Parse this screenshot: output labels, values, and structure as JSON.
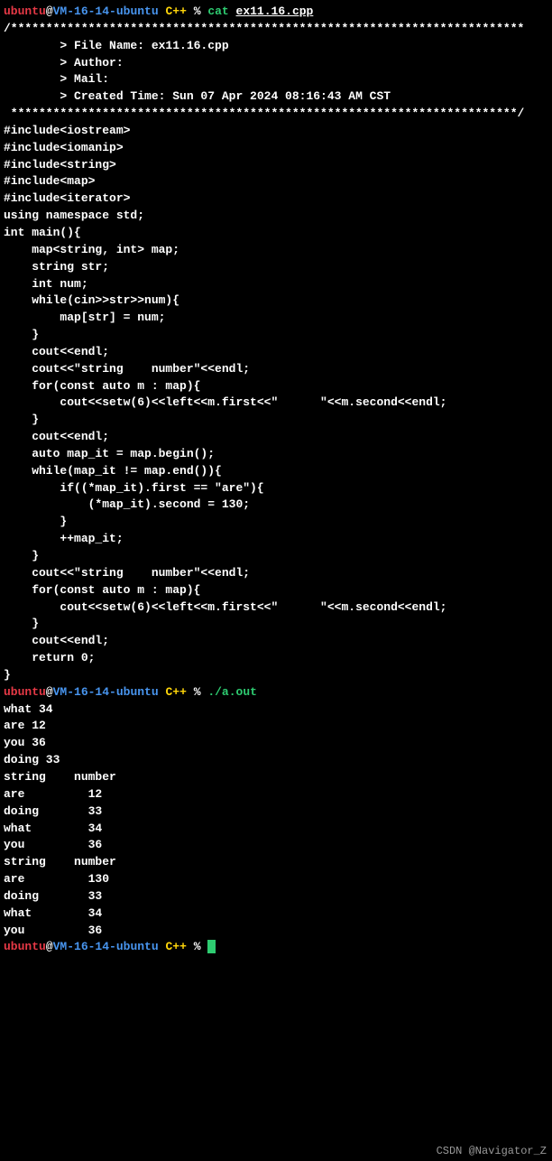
{
  "prompt": {
    "user": "ubuntu",
    "at": "@",
    "host": "VM-16-14-ubuntu",
    "cpp": "C++",
    "pct": "%"
  },
  "cmd1": {
    "name": "cat",
    "file": "ex11.16.cpp"
  },
  "code": {
    "l1": "/*************************************************************************",
    "l2": "        > File Name: ex11.16.cpp",
    "l3": "        > Author:",
    "l4": "        > Mail:",
    "l5": "        > Created Time: Sun 07 Apr 2024 08:16:43 AM CST",
    "l6": " ************************************************************************/",
    "l7": "",
    "l8": "#include<iostream>",
    "l9": "#include<iomanip>",
    "l10": "#include<string>",
    "l11": "#include<map>",
    "l12": "#include<iterator>",
    "l13": "using namespace std;",
    "l14": "",
    "l15": "int main(){",
    "l16": "    map<string, int> map;",
    "l17": "    string str;",
    "l18": "    int num;",
    "l19": "",
    "l20": "    while(cin>>str>>num){",
    "l21": "        map[str] = num;",
    "l22": "    }",
    "l23": "",
    "l24": "    cout<<endl;",
    "l25": "    cout<<\"string    number\"<<endl;",
    "l26": "    for(const auto m : map){",
    "l27": "        cout<<setw(6)<<left<<m.first<<\"      \"<<m.second<<endl;",
    "l28": "    }",
    "l29": "    cout<<endl;",
    "l30": "",
    "l31": "    auto map_it = map.begin();",
    "l32": "    while(map_it != map.end()){",
    "l33": "        if((*map_it).first == \"are\"){",
    "l34": "            (*map_it).second = 130;",
    "l35": "        }",
    "l36": "        ++map_it;",
    "l37": "    }",
    "l38": "",
    "l39": "    cout<<\"string    number\"<<endl;",
    "l40": "    for(const auto m : map){",
    "l41": "        cout<<setw(6)<<left<<m.first<<\"      \"<<m.second<<endl;",
    "l42": "    }",
    "l43": "    cout<<endl;",
    "l44": "",
    "l45": "",
    "l46": "    return 0;",
    "l47": "}"
  },
  "cmd2": {
    "exec": "./a.out"
  },
  "output": {
    "l1": "what 34",
    "l2": "are 12",
    "l3": "you 36",
    "l4": "doing 33",
    "l5": "",
    "l6": "string    number",
    "l7": "are         12",
    "l8": "doing       33",
    "l9": "what        34",
    "l10": "you         36",
    "l11": "",
    "l12": "string    number",
    "l13": "are         130",
    "l14": "doing       33",
    "l15": "what        34",
    "l16": "you         36"
  },
  "watermark": "CSDN @Navigator_Z"
}
